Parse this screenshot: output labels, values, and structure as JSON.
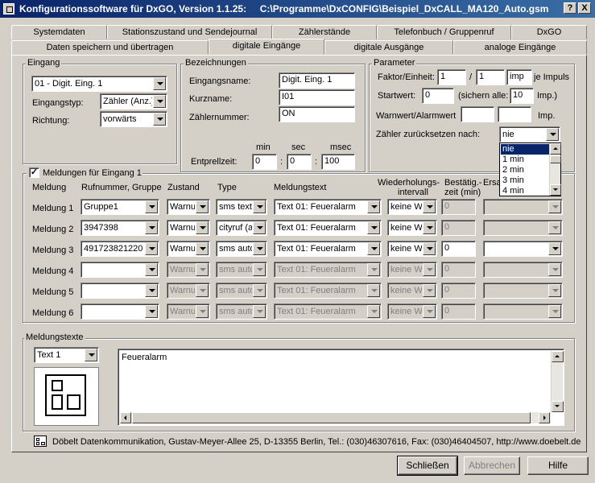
{
  "window": {
    "title": "Konfigurationssoftware für DxGO, Version 1.1.25:     C:\\Programme\\DxCONFIG\\Beispiel_DxCALL_MA120_Auto.gsm",
    "help_btn": "?",
    "close_btn": "X"
  },
  "tabs_row1": [
    "Systemdaten",
    "Stationszustand und Sendejournal",
    "Zählerstände",
    "Telefonbuch / Gruppenruf",
    "DxGO"
  ],
  "tabs_row2": [
    "Daten speichern und übertragen",
    "digitale Eingänge",
    "digitale Ausgänge",
    "analoge Eingänge"
  ],
  "eingang": {
    "title": "Eingang",
    "select": "01 - Digit. Eing. 1",
    "typ_label": "Eingangstyp:",
    "typ_value": "Zähler (Anz.)",
    "richtung_label": "Richtung:",
    "richtung_value": "vorwärts"
  },
  "bezeichnungen": {
    "title": "Bezeichnungen",
    "name_label": "Eingangsname:",
    "name_value": "Digit. Eing. 1",
    "kurzname_label": "Kurzname:",
    "kurzname_value": "I01",
    "zaehler_label": "Zählernummer:",
    "zaehler_value": "ON",
    "entprell_label": "Entprellzeit:",
    "min_label": "min",
    "sec_label": "sec",
    "msec_label": "msec",
    "min_value": "0",
    "sec_value": "0",
    "msec_value": "100",
    "sep": ":"
  },
  "parameter": {
    "title": "Parameter",
    "faktor_label": "Faktor/Einheit:",
    "faktor_a": "1",
    "slash": "/",
    "faktor_b": "1",
    "einheit": "imp",
    "impuls_label": "je Impuls",
    "start_label": "Startwert:",
    "start_value": "0",
    "sichern_label": "(sichern alle:",
    "sichern_value": "10",
    "imp_label": "Imp.)",
    "warn_label": "Warnwert/Alarmwert",
    "warn_value": "",
    "alarm_value": "",
    "imp2_label": "Imp.",
    "reset_label": "Zähler zurücksetzen nach:",
    "reset_value": "nie",
    "reset_options": [
      "nie",
      "1 min",
      "2 min",
      "3 min",
      "4 min"
    ]
  },
  "meldungen": {
    "checkbox_label": "Meldungen für Eingang 1",
    "checked": "✓",
    "headers": {
      "meldung": "Meldung",
      "ruf": "Rufnummer, Gruppe",
      "zustand": "Zustand",
      "type": "Type",
      "text": "Meldungstext",
      "wdh1": "Wiederholungs-",
      "wdh2": "intervall",
      "best1": "Bestätig.-",
      "best2": "zeit (min)",
      "ers": "Ersa"
    },
    "rows": [
      {
        "label": "Meldung 1",
        "ruf": "Gruppe1",
        "zustand": "Warnu",
        "type": "sms text",
        "text": "Text 01:  Feueralarm",
        "wdh": "keine W",
        "best": "0",
        "active": true
      },
      {
        "label": "Meldung 2",
        "ruf": "3947398",
        "zustand": "Warnu",
        "type": "cityruf (al",
        "text": "Text 01:  Feueralarm",
        "wdh": "keine W",
        "best": "0",
        "active": true
      },
      {
        "label": "Meldung 3",
        "ruf": "491723821220",
        "zustand": "Warnu",
        "type": "sms auto",
        "text": "Text 01:  Feueralarm",
        "wdh": "keine W",
        "best": "0",
        "active": true
      },
      {
        "label": "Meldung 4",
        "ruf": "",
        "zustand": "Warnu",
        "type": "sms auto",
        "text": "Text 01:  Feueralarm",
        "wdh": "keine W",
        "best": "0",
        "active": false
      },
      {
        "label": "Meldung 5",
        "ruf": "",
        "zustand": "Warnu",
        "type": "sms auto",
        "text": "Text 01:  Feueralarm",
        "wdh": "keine W",
        "best": "0",
        "active": false
      },
      {
        "label": "Meldung 6",
        "ruf": "",
        "zustand": "Warnu",
        "type": "sms auto",
        "text": "Text 01:  Feueralarm",
        "wdh": "keine W",
        "best": "0",
        "active": false
      }
    ]
  },
  "meldungstexte": {
    "title": "Meldungstexte",
    "select": "Text 1",
    "content": "Feueralarm"
  },
  "footer": {
    "company": "Döbelt Datenkommunikation, Gustav-Meyer-Allee 25, D-13355 Berlin, Tel.: (030)46307616, Fax: (030)46404507, http://www.doebelt.de"
  },
  "buttons": {
    "schliessen": "Schließen",
    "abbrechen": "Abbrechen",
    "hilfe": "Hilfe"
  },
  "colors": {
    "titlebar": "#0a246a",
    "face": "#d4d0c8",
    "selection": "#0a246a"
  }
}
